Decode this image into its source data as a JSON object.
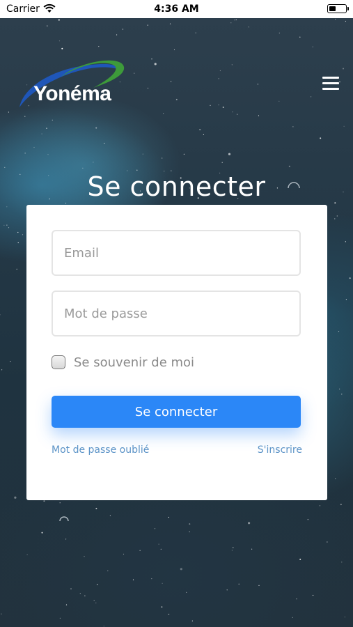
{
  "status_bar": {
    "carrier": "Carrier",
    "time": "4:36 AM",
    "battery_level": 0.4
  },
  "header": {
    "logo_text": "Yonéma",
    "menu_icon": "hamburger-menu-icon"
  },
  "page": {
    "title": "Se connecter"
  },
  "form": {
    "email_placeholder": "Email",
    "email_value": "",
    "password_placeholder": "Mot de passe",
    "password_value": "",
    "remember_label": "Se souvenir de moi",
    "remember_checked": false,
    "submit_label": "Se connecter",
    "forgot_link": "Mot de passe oublié",
    "signup_link": "S'inscrire"
  },
  "colors": {
    "primary_button": "#2b87f7",
    "link": "#5b93c7",
    "logo_blue": "#1f56b8",
    "logo_green": "#3d9a3a"
  }
}
